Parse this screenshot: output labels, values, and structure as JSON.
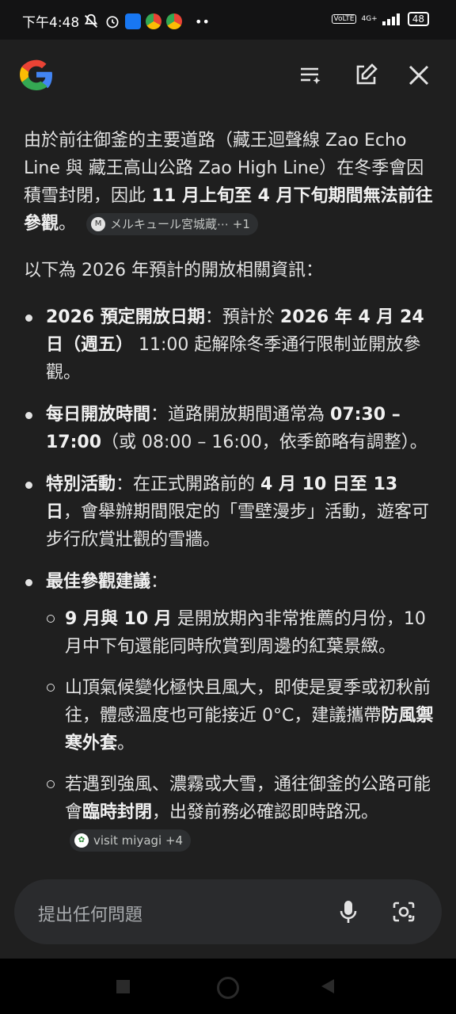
{
  "status": {
    "time": "下午4:48",
    "network": "4G+",
    "volte": "VoLTE",
    "battery": "48"
  },
  "header": {
    "logo": "google-logo",
    "icons": [
      "tune-list-icon",
      "edit-icon",
      "close-icon"
    ]
  },
  "answer": {
    "p1_a": "由於前往御釜的主要道路（藏王迴聲線 Zao Echo Line 與 藏王高山公路 Zao High Line）在冬季會因積雪封閉，因此",
    "p1_b": " 11 月上旬至 4 月下旬期間無法前往參觀",
    "p1_c": "。",
    "chip1": "メルキュール宮城蔵⋯ +1",
    "p2": "以下為 2026 年預計的開放相關資訊：",
    "b1_t": "2026 預定開放日期",
    "b1_a": "：預計於 ",
    "b1_b": "2026 年 4 月 24 日（週五）",
    "b1_c": " 11:00 起解除冬季通行限制並開放參觀。",
    "b2_t": "每日開放時間",
    "b2_a": "：道路開放期間通常為 ",
    "b2_b": "07:30 – 17:00",
    "b2_c": "（或 08:00 – 16:00，依季節略有調整）。",
    "b3_t": "特別活動",
    "b3_a": "：在正式開路前的 ",
    "b3_b": "4 月 10 日至 13 日",
    "b3_c": "，會舉辦期間限定的「雪壁漫步」活動，遊客可步行欣賞壯觀的雪牆。",
    "b4_t": "最佳參觀建議",
    "b4_a": "：",
    "s1_b": "9 月與 10 月",
    "s1_a": " 是開放期內非常推薦的月份，10 月中下旬還能同時欣賞到周邊的紅葉景緻。",
    "s2_a": "山頂氣候變化極快且風大，即使是夏季或初秋前往，體感溫度也可能接近 0°C，建議攜帶",
    "s2_b": "防風禦寒外套",
    "s2_c": "。",
    "s3_a": "若遇到強風、濃霧或大雪，通往御釜的公路可能會",
    "s3_b": "臨時封閉",
    "s3_c": "，出發前務必確認即時路況。",
    "chip2": "visit miyagi +4"
  },
  "input": {
    "placeholder": "提出任何問題"
  },
  "colors": {
    "background": "#1f1f1f",
    "text": "#e3e3e3",
    "chip": "#2d2f31",
    "input": "#2a2b2d"
  }
}
